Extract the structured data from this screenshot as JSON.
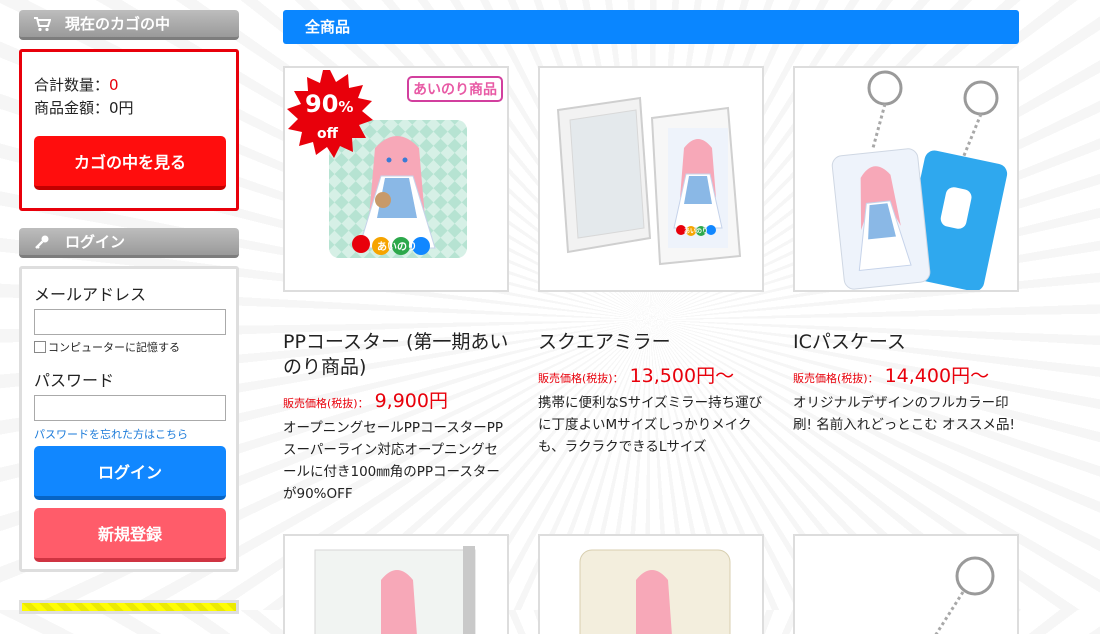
{
  "cart": {
    "header": "現在のカゴの中",
    "quantity_label": "合計数量：",
    "quantity_value": "0",
    "amount_label": "商品金額：",
    "amount_value": "0円",
    "view_button": "カゴの中を見る"
  },
  "login": {
    "header": "ログイン",
    "email_label": "メールアドレス",
    "remember_label": "コンピューターに記憶する",
    "password_label": "パスワード",
    "forgot_link": "パスワードを忘れた方はこちら",
    "login_button": "ログイン",
    "register_button": "新規登録"
  },
  "main": {
    "section_title": "全商品",
    "price_label": "販売価格(税抜)：",
    "products": [
      {
        "title": "PPコースター (第一期あいのり商品)",
        "price": "9,900円",
        "badge_percent": "90",
        "badge_percent_sign": "%",
        "badge_off": "off",
        "brand_tag": "あいのり商品",
        "image_caption": "あいのり",
        "desc": "オープニングセールPPコースターPPスーパーライン対応オープニングセールに付き100㎜角のPPコースターが90%OFF"
      },
      {
        "title": "スクエアミラー",
        "price": "13,500円～",
        "image_caption": "あいのり",
        "desc": "携帯に便利なSサイズミラー持ち運びに丁度よいMサイズしっかりメイクも、ラクラクできるLサイズ"
      },
      {
        "title": "ICパスケース",
        "price": "14,400円～",
        "desc": "オリジナルデザインのフルカラー印刷! 名前入れどっとこむ オススメ品!"
      }
    ]
  },
  "colors": {
    "red": "#e8000b",
    "blue": "#0a86ff",
    "pink_button": "#ff5c6a"
  }
}
